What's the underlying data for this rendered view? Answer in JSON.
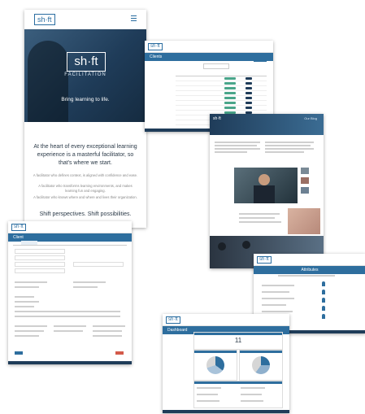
{
  "hero": {
    "logo": "sh·ft",
    "title_logo": "sh·ft",
    "subtitle": "FACILITATION",
    "tagline": "Bring learning to life.",
    "heading": "At the heart of every exceptional learning experience is a masterful facilitator, so that's where we start.",
    "paragraph_1": "A facilitator who defines context, is aligned with confidence and ease.",
    "paragraph_2": "A facilitator who transforms learning environments, and makes learning fun and engaging.",
    "paragraph_3": "A facilitator who knows where and where and lives their organization.",
    "slogan": "Shift perspectives. Shift possibilities."
  },
  "clients_screen": {
    "title": "Clients",
    "logo": "sh·ft",
    "rows": 15
  },
  "client_form": {
    "title": "Client",
    "logo": "sh·ft"
  },
  "articles": {
    "logo": "sh·ft",
    "section": "Our Blog"
  },
  "attributes": {
    "logo": "sh·ft",
    "title": "Attributes"
  },
  "dashboard": {
    "logo": "sh·ft",
    "title": "Dashboard",
    "count": "11"
  },
  "colors": {
    "brand_blue": "#2e6e9e",
    "accent_green": "#4aa58a",
    "dark_blue": "#1f3c59"
  }
}
